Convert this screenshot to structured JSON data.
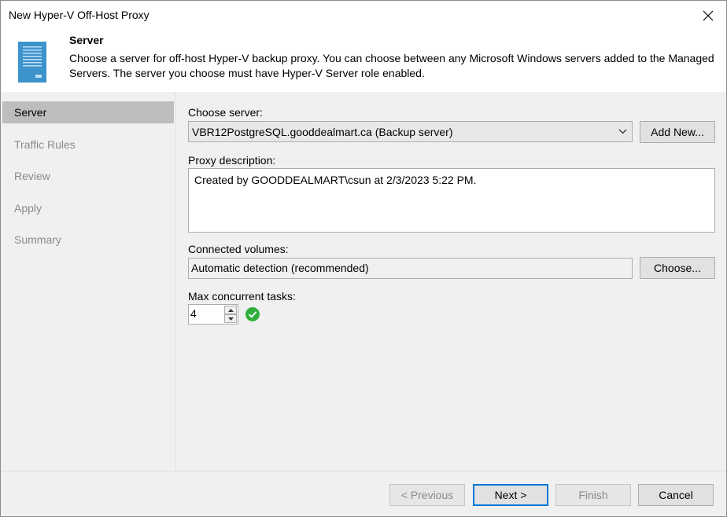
{
  "window": {
    "title": "New Hyper-V Off-Host Proxy"
  },
  "header": {
    "title": "Server",
    "description": "Choose a server for off-host Hyper-V backup proxy. You can choose between any Microsoft Windows servers added to the Managed Servers. The server you choose must have Hyper-V Server role enabled."
  },
  "nav": {
    "items": [
      {
        "label": "Server",
        "active": true
      },
      {
        "label": "Traffic Rules",
        "active": false
      },
      {
        "label": "Review",
        "active": false
      },
      {
        "label": "Apply",
        "active": false
      },
      {
        "label": "Summary",
        "active": false
      }
    ]
  },
  "form": {
    "choose_server_label": "Choose server:",
    "server_value": "VBR12PostgreSQL.gooddealmart.ca (Backup server)",
    "add_new_label": "Add New...",
    "proxy_description_label": "Proxy description:",
    "proxy_description_value": "Created by GOODDEALMART\\csun at 2/3/2023 5:22 PM.",
    "connected_volumes_label": "Connected volumes:",
    "connected_volumes_value": "Automatic detection (recommended)",
    "choose_label": "Choose...",
    "max_tasks_label": "Max concurrent tasks:",
    "max_tasks_value": "4"
  },
  "footer": {
    "previous_label": "< Previous",
    "next_label": "Next >",
    "finish_label": "Finish",
    "cancel_label": "Cancel"
  },
  "icons": {
    "close": "close-icon",
    "server": "server-icon",
    "dropdown": "chevron-down-icon",
    "check": "check-icon"
  },
  "colors": {
    "accent": "#0078d7",
    "server_icon": "#3d93cc",
    "check_ok": "#2fae3c",
    "nav_active": "#bdbdbd"
  }
}
